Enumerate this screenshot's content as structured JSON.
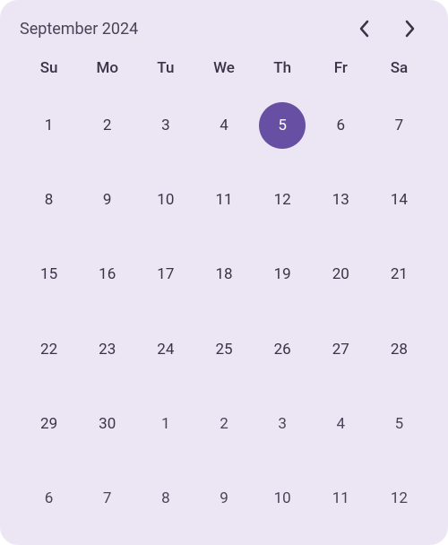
{
  "header": {
    "title": "September 2024"
  },
  "weekdays": [
    "Su",
    "Mo",
    "Tu",
    "We",
    "Th",
    "Fr",
    "Sa"
  ],
  "days": [
    {
      "d": "1",
      "current": true,
      "sel": false
    },
    {
      "d": "2",
      "current": true,
      "sel": false
    },
    {
      "d": "3",
      "current": true,
      "sel": false
    },
    {
      "d": "4",
      "current": true,
      "sel": false
    },
    {
      "d": "5",
      "current": true,
      "sel": true
    },
    {
      "d": "6",
      "current": true,
      "sel": false
    },
    {
      "d": "7",
      "current": true,
      "sel": false
    },
    {
      "d": "8",
      "current": true,
      "sel": false
    },
    {
      "d": "9",
      "current": true,
      "sel": false
    },
    {
      "d": "10",
      "current": true,
      "sel": false
    },
    {
      "d": "11",
      "current": true,
      "sel": false
    },
    {
      "d": "12",
      "current": true,
      "sel": false
    },
    {
      "d": "13",
      "current": true,
      "sel": false
    },
    {
      "d": "14",
      "current": true,
      "sel": false
    },
    {
      "d": "15",
      "current": true,
      "sel": false
    },
    {
      "d": "16",
      "current": true,
      "sel": false
    },
    {
      "d": "17",
      "current": true,
      "sel": false
    },
    {
      "d": "18",
      "current": true,
      "sel": false
    },
    {
      "d": "19",
      "current": true,
      "sel": false
    },
    {
      "d": "20",
      "current": true,
      "sel": false
    },
    {
      "d": "21",
      "current": true,
      "sel": false
    },
    {
      "d": "22",
      "current": true,
      "sel": false
    },
    {
      "d": "23",
      "current": true,
      "sel": false
    },
    {
      "d": "24",
      "current": true,
      "sel": false
    },
    {
      "d": "25",
      "current": true,
      "sel": false
    },
    {
      "d": "26",
      "current": true,
      "sel": false
    },
    {
      "d": "27",
      "current": true,
      "sel": false
    },
    {
      "d": "28",
      "current": true,
      "sel": false
    },
    {
      "d": "29",
      "current": true,
      "sel": false
    },
    {
      "d": "30",
      "current": true,
      "sel": false
    },
    {
      "d": "1",
      "current": false,
      "sel": false
    },
    {
      "d": "2",
      "current": false,
      "sel": false
    },
    {
      "d": "3",
      "current": false,
      "sel": false
    },
    {
      "d": "4",
      "current": false,
      "sel": false
    },
    {
      "d": "5",
      "current": false,
      "sel": false
    },
    {
      "d": "6",
      "current": false,
      "sel": false
    },
    {
      "d": "7",
      "current": false,
      "sel": false
    },
    {
      "d": "8",
      "current": false,
      "sel": false
    },
    {
      "d": "9",
      "current": false,
      "sel": false
    },
    {
      "d": "10",
      "current": false,
      "sel": false
    },
    {
      "d": "11",
      "current": false,
      "sel": false
    },
    {
      "d": "12",
      "current": false,
      "sel": false
    }
  ]
}
